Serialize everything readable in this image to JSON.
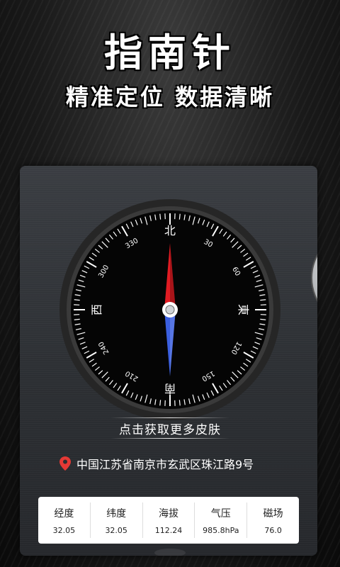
{
  "header": {
    "title": "指南针",
    "subtitle": "精准定位 数据清晰"
  },
  "compass": {
    "north": "北",
    "east": "東",
    "south": "南",
    "west": "西",
    "degree_labels": [
      "30",
      "60",
      "120",
      "150",
      "210",
      "240",
      "300",
      "330"
    ],
    "needle_north_color": "#e11b22",
    "needle_south_color": "#3a5fe0"
  },
  "skin_button": {
    "label": "点击获取更多皮肤"
  },
  "location": {
    "address": "中国江苏省南京市玄武区珠江路9号",
    "pin_color": "#e53935"
  },
  "stats": [
    {
      "label": "经度",
      "value": "32.05"
    },
    {
      "label": "纬度",
      "value": "32.05"
    },
    {
      "label": "海拔",
      "value": "112.24"
    },
    {
      "label": "气压",
      "value": "985.8hPa"
    },
    {
      "label": "磁场",
      "value": "76.0"
    }
  ]
}
